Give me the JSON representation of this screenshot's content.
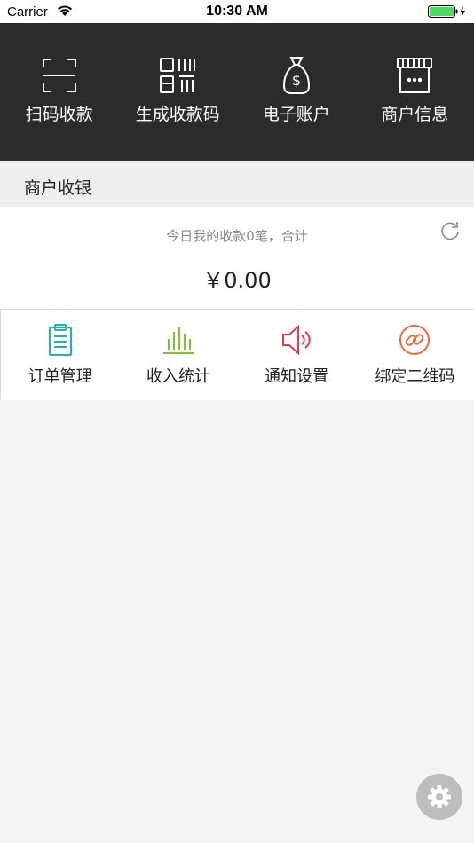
{
  "status_bar": {
    "carrier": "Carrier",
    "time": "10:30 AM"
  },
  "top_nav": {
    "items": [
      {
        "label": "扫码收款",
        "icon": "scan-icon"
      },
      {
        "label": "生成收款码",
        "icon": "qrcode-icon"
      },
      {
        "label": "电子账户",
        "icon": "money-bag-icon"
      },
      {
        "label": "商户信息",
        "icon": "store-icon"
      }
    ]
  },
  "section": {
    "title": "商户收银"
  },
  "summary": {
    "today_text": "今日我的收款0笔，合计",
    "amount": "￥0.00"
  },
  "functions": {
    "items": [
      {
        "label": "订单管理",
        "icon": "clipboard-icon",
        "color": "#1fb5ad"
      },
      {
        "label": "收入统计",
        "icon": "bar-stats-icon",
        "color": "#7dc22a"
      },
      {
        "label": "通知设置",
        "icon": "speaker-icon",
        "color": "#e8384f"
      },
      {
        "label": "绑定二维码",
        "icon": "link-icon",
        "color": "#f0693a"
      }
    ]
  },
  "colors": {
    "nav_background": "#2b2b2f",
    "page_background": "#f4f4f4",
    "battery": "#4cd964",
    "settings_button": "#bdbdbd"
  }
}
